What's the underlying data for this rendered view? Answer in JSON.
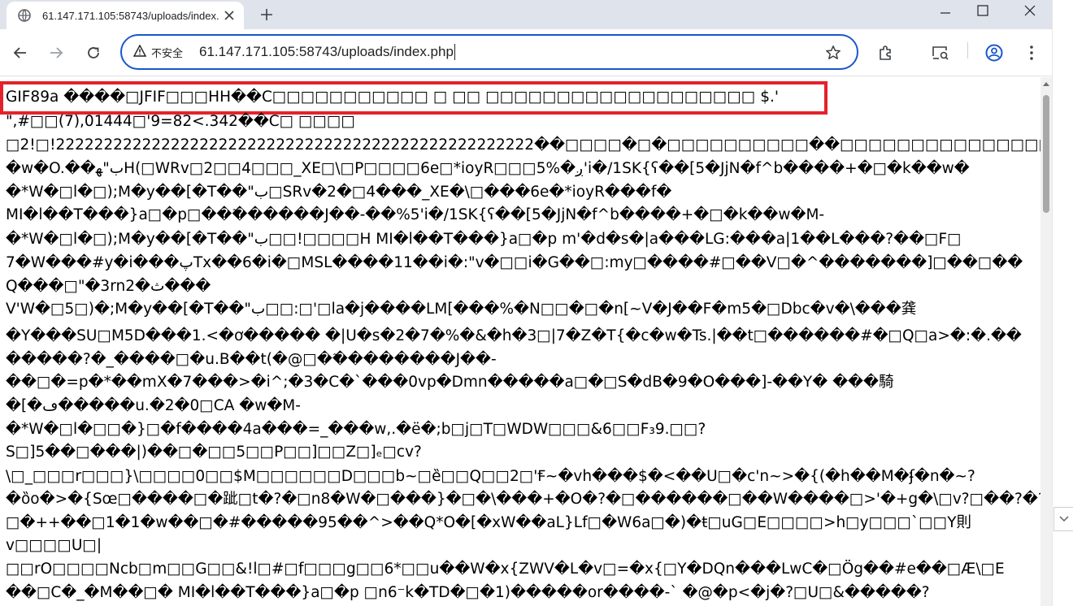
{
  "browser": {
    "tab_title": "61.147.171.105:58743/uploads/index.php",
    "security_label": "不安全",
    "url": "61.147.171.105:58743/uploads/index.php"
  },
  "icons": [
    "globe-icon",
    "close-icon",
    "plus-icon",
    "minimize-icon",
    "maximize-icon",
    "close-window-icon",
    "back-arrow-icon",
    "forward-arrow-icon",
    "reload-icon",
    "warning-icon",
    "star-icon",
    "extensions-icon",
    "cast-search-icon",
    "profile-icon",
    "more-vert-icon"
  ],
  "colors": {
    "omnibox_border": "#1a57c9",
    "highlight_box": "#e5212b",
    "tabstrip_bg": "#dfe3eb"
  },
  "content": {
    "lines": [
      "GIF89a ����□JFIF□□□HH��C□□□□□□□□□□□ □ □□ □□□□□□□□□□□□□□□□□□□ $.'",
      "\",#□□(7),01444□'9=82<.342��C□ □□□□",
      "□2!□!22222222222222222222222222222222222222222222222222��□□□□�□�□□□□□□□□□□��□□□□□□□□□□□□□□□�□□□□",
      "�w�O.��ب\"ﻬH(□WRv□2□□4□□□_XE□\\□P□□□□6e□*ioyR□□□5%�ږ'i�/1SK{ʕ��[5�JjN�f^b����+�□�k��w�",
      "�*W�□l�□);M�y��[�T��\"ب□SRv�2�□4���_XE�\\□���6e�*ioyR���f�",
      "MI�l��T���}a□�p□���ٓ�����J��-��%5'i�/1SK{ʕ��[5�JjN�f^b����+�□�k��w�M-",
      "�*W�□l�□);M�y��[�T��\"ب□□!□□□□H MI�l��T���}a□�p m'�d�s�|a���LG:���a|1��L���?��□F□",
      "7�W���#y�i���پTx��6�i�□MSL����11��i�:\"v�□□i�G��□:my□����#□��V□�^�������]□��□��",
      "Q���□\"�3rn2�ث���",
      "V'W�□5□)�;M�y��[�T��\"ب□□:□'□la�j����LM[���%�N□□�□�n[~V�J��F�m5�□Dbc�v�\\���龚",
      "�Y���SU□M5D���1.<�ơ����� �|U�s�2�7�%�&�h�3□|7�Z�T{�c�w�Ts.|��t□������#�□Q□a>�:�.��",
      "�����?�_����□�u.B��t(�@□��ٓ�������J��-",
      "��□�=p�*��mX�7���>�i^;�3�C�`���0vp�Dmn�����a□�□S�dB�9�O���]-��Y� ���騎",
      "�[�ڡ�����u.�2�0□CA �w�M-",
      "�*W�□l�□□�}□�f����4a���=_���w,.�ë�;b□j□T□WDW□□□&6□□F₃9.□□?",
      "S□]5��□���|)��□�□□5□□P□□]□□Z□]ₑ□cv?",
      "\\□_□□□r□□□}\\□□□□0□□$M□□□□□□D□□□b~□ȅ□□Q□□2□'Ꞙ~�vh���$�<��U□�c'n~>�{(�h��M�ʄ�n�~?",
      "�ȍo�>�{Sœ□����□�跐□t�?�□n8�W�□���}�□�\\���+�O�?�□������□��W����□>'�+g�\\□v?□��?�?",
      "□�++��□1�1�w��□�#�����95��^>��Q*O�[�xW��aL}Lf□�W6a□�)�ŧ□uG□E□□□□>h□y□□□`□□Y則",
      "v□□□□U□|",
      "□□rO□□□□Ncb□m□□G□□&!l□#□f□□□g□□6*□□u��W�x{ZWV�L�v□=�x{□Y�DQn���LwC�□Ög��#e��□Æ\\□E",
      "��□C�_�M��□� MI�l��T���}a□�p □n6⁻k�TD�□�1)�����or����-` �@�p<�j�?□U□&�����?"
    ]
  }
}
